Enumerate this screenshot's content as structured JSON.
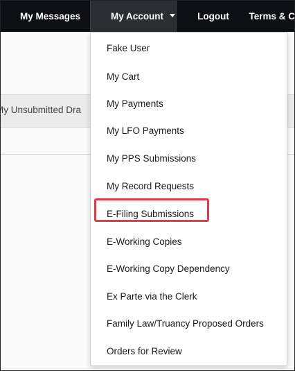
{
  "navbar": {
    "items": [
      {
        "label": "My Messages"
      },
      {
        "label": "My Account"
      },
      {
        "label": "Logout"
      },
      {
        "label": "Terms & C"
      }
    ]
  },
  "background": {
    "tab_label": "My Unsubmitted Dra"
  },
  "account_menu": {
    "items": [
      {
        "label": "Fake User"
      },
      {
        "label": "My Cart"
      },
      {
        "label": "My Payments"
      },
      {
        "label": "My LFO Payments"
      },
      {
        "label": "My PPS Submissions"
      },
      {
        "label": "My Record Requests"
      },
      {
        "label": "E-Filing Submissions",
        "highlighted": true
      },
      {
        "label": "E-Working Copies"
      },
      {
        "label": "E-Working Copy Dependency"
      },
      {
        "label": "Ex Parte via the Clerk"
      },
      {
        "label": "Family Law/Truancy Proposed Orders"
      },
      {
        "label": "Orders for Review"
      }
    ]
  },
  "colors": {
    "navbar_bg": "#0d0f14",
    "active_nav_bg": "#2b2d33",
    "highlight_border": "#e53946"
  }
}
